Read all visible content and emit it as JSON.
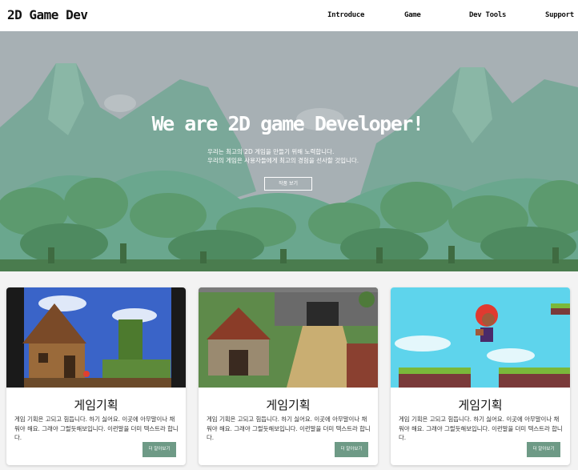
{
  "header": {
    "logo": "2D Game Dev",
    "nav": [
      "Introduce",
      "Game",
      "Dev Tools",
      "Support"
    ]
  },
  "hero": {
    "title": "We are 2D game Developer!",
    "subtitle_line1": "우리는 최고의 2D 게임을 만들기 위해 노력합니다.",
    "subtitle_line2": "우리의 게임은 사용자들에게 최고의 경험을 선사할 것입니다.",
    "button": "작품 보기"
  },
  "cards": [
    {
      "title": "게임기획",
      "desc": "게임 기획은 고되고 힘듭니다. 하기 싫어요. 이곳에 아무말이나 채워야 해요. 그래야 그럴듯해보입니다. 이런말을 더미 텍스트라 합니다.",
      "button": "더 알아보기"
    },
    {
      "title": "게임기획",
      "desc": "게임 기획은 고되고 힘듭니다. 하기 싫어요. 이곳에 아무말이나 채워야 해요. 그래야 그럴듯해보입니다. 이런말을 더미 텍스트라 합니다.",
      "button": "더 알아보기"
    },
    {
      "title": "게임기획",
      "desc": "게임 기획은 고되고 힘듭니다. 하기 싫어요. 이곳에 아무말이나 채워야 해요. 그래야 그럴듯해보입니다. 이런말을 더미 텍스트라 합니다.",
      "button": "더 알아보기"
    }
  ],
  "colors": {
    "accent": "#6e9a86",
    "hero_sky": "#a7b0b4",
    "hero_hills": "#6aa78e",
    "hero_trees": "#5c9a6e"
  }
}
